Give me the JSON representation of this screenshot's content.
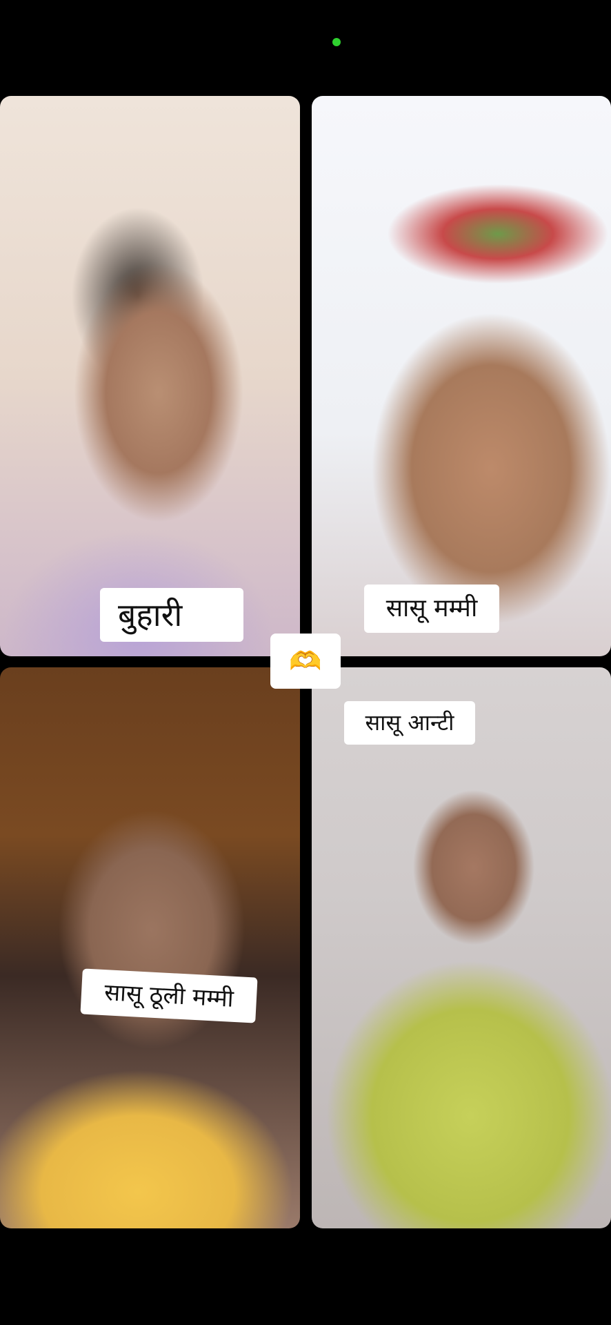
{
  "call": {
    "status_indicator_color": "#2fd12f"
  },
  "participants": [
    {
      "label": "बुहारी"
    },
    {
      "label": "सासू मम्मी"
    },
    {
      "label": "सासू आन्टी"
    },
    {
      "label": "सासू ठूली मम्मी"
    }
  ],
  "reaction": {
    "glyph": "🫶",
    "icon": "heart-hands-icon"
  }
}
